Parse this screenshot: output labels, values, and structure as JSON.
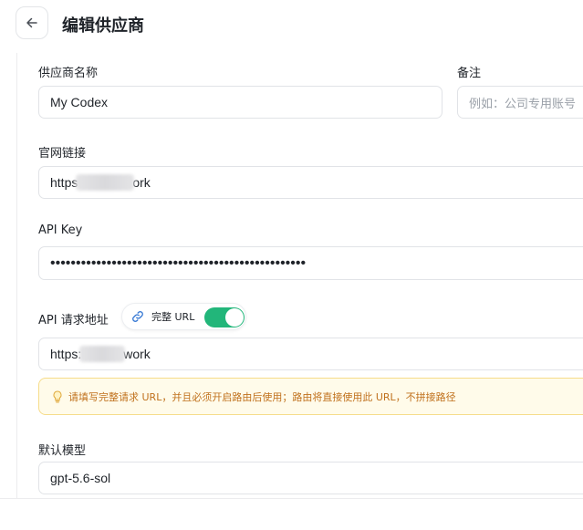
{
  "header": {
    "title": "编辑供应商"
  },
  "form": {
    "name": {
      "label": "供应商名称",
      "value": "My Codex"
    },
    "note": {
      "label": "备注",
      "placeholder": "例如：公司专用账号"
    },
    "website": {
      "label": "官网链接",
      "value_prefix": "https",
      "value_suffix": "ork"
    },
    "api_key": {
      "label": "API Key",
      "value": "••••••••••••••••••••••••••••••••••••••••••••••••••"
    },
    "api_url": {
      "label": "API 请求地址",
      "full_url_toggle": {
        "label": "完整 URL",
        "enabled": true
      },
      "value_prefix": "https:",
      "value_suffix": "work",
      "hint": "请填写完整请求 URL，并且必须开启路由后使用；路由将直接使用此 URL，不拼接路径"
    },
    "default_model": {
      "label": "默认模型",
      "value": "gpt-5.6-sol"
    }
  },
  "colors": {
    "accent": "#22b67a",
    "hint_bg": "#fffbea",
    "hint_text": "#c0711d"
  }
}
